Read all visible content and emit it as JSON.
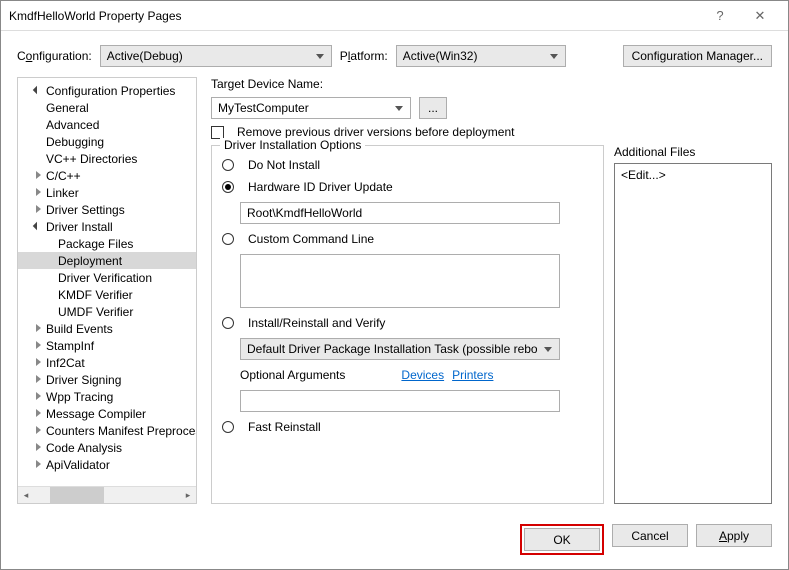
{
  "title": "KmdfHelloWorld Property Pages",
  "toprow": {
    "configLabelPre": "C",
    "configLabelU": "o",
    "configLabelPost": "nfiguration:",
    "configValue": "Active(Debug)",
    "platformLabelPre": "P",
    "platformLabelU": "l",
    "platformLabelPost": "atform:",
    "platformValue": "Active(Win32)",
    "cfgMgr": "Configuration Manager..."
  },
  "tree": [
    {
      "label": "Configuration Properties",
      "type": "open",
      "cls": ""
    },
    {
      "label": "General",
      "type": "leaf",
      "cls": "indent1"
    },
    {
      "label": "Advanced",
      "type": "leaf",
      "cls": "indent1"
    },
    {
      "label": "Debugging",
      "type": "leaf",
      "cls": "indent1"
    },
    {
      "label": "VC++ Directories",
      "type": "leaf",
      "cls": "indent1"
    },
    {
      "label": "C/C++",
      "type": "closed",
      "cls": ""
    },
    {
      "label": "Linker",
      "type": "closed",
      "cls": ""
    },
    {
      "label": "Driver Settings",
      "type": "closed",
      "cls": ""
    },
    {
      "label": "Driver Install",
      "type": "open",
      "cls": ""
    },
    {
      "label": "Package Files",
      "type": "leaf",
      "cls": "indent2"
    },
    {
      "label": "Deployment",
      "type": "leaf",
      "cls": "indent2",
      "selected": true
    },
    {
      "label": "Driver Verification",
      "type": "leaf",
      "cls": "indent2"
    },
    {
      "label": "KMDF Verifier",
      "type": "leaf",
      "cls": "indent2"
    },
    {
      "label": "UMDF Verifier",
      "type": "leaf",
      "cls": "indent2"
    },
    {
      "label": "Build Events",
      "type": "closed",
      "cls": ""
    },
    {
      "label": "StampInf",
      "type": "closed",
      "cls": ""
    },
    {
      "label": "Inf2Cat",
      "type": "closed",
      "cls": ""
    },
    {
      "label": "Driver Signing",
      "type": "closed",
      "cls": ""
    },
    {
      "label": "Wpp Tracing",
      "type": "closed",
      "cls": ""
    },
    {
      "label": "Message Compiler",
      "type": "closed",
      "cls": ""
    },
    {
      "label": "Counters Manifest Preprocessor",
      "type": "closed",
      "cls": ""
    },
    {
      "label": "Code Analysis",
      "type": "closed",
      "cls": ""
    },
    {
      "label": "ApiValidator",
      "type": "closed",
      "cls": ""
    }
  ],
  "main": {
    "targetDeviceLabel": "Target Device Name:",
    "targetDeviceValue": "MyTestComputer",
    "browseBtn": "...",
    "removeChk": "Remove previous driver versions before deployment",
    "dioLegend": "Driver Installation Options",
    "optDoNotInstall": "Do Not Install",
    "optHwId": "Hardware ID Driver Update",
    "hwIdValue": "Root\\KmdfHelloWorld",
    "optCustom": "Custom Command Line",
    "optInstallVerify": "Install/Reinstall and Verify",
    "installTask": "Default Driver Package Installation Task (possible reboot)",
    "optionalArgs": "Optional Arguments",
    "linkDevices": "Devices",
    "linkPrinters": "Printers",
    "optFast": "Fast Reinstall",
    "addFilesLabel": "Additional Files",
    "addFilesValue": "<Edit...>"
  },
  "footer": {
    "ok": "OK",
    "cancel": "Cancel",
    "applyPre": "",
    "applyU": "A",
    "applyPost": "pply"
  }
}
